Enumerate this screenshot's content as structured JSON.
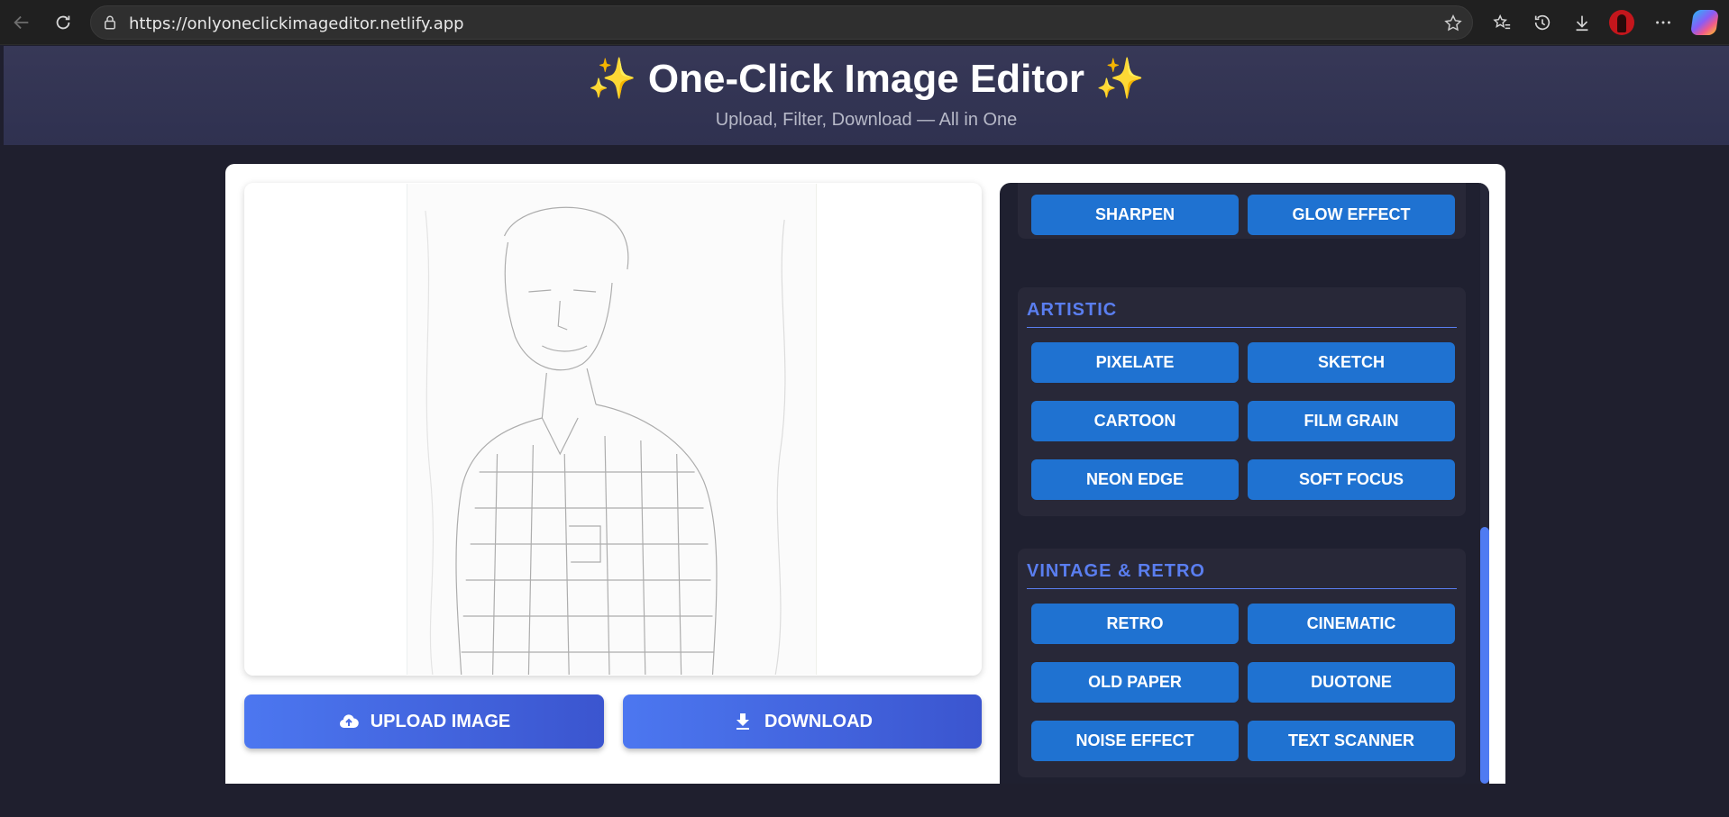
{
  "browser": {
    "url": "https://onlyoneclickimageditor.netlify.app"
  },
  "header": {
    "title": "✨ One-Click Image Editor ✨",
    "subtitle": "Upload, Filter, Download — All in One"
  },
  "actions": {
    "upload_label": "UPLOAD IMAGE",
    "download_label": "DOWNLOAD"
  },
  "filters": {
    "top": [
      "SHARPEN",
      "GLOW EFFECT"
    ],
    "artistic": {
      "title": "ARTISTIC",
      "buttons": [
        "PIXELATE",
        "SKETCH",
        "CARTOON",
        "FILM GRAIN",
        "NEON EDGE",
        "SOFT FOCUS"
      ]
    },
    "vintage": {
      "title": "VINTAGE & RETRO",
      "buttons": [
        "RETRO",
        "CINEMATIC",
        "OLD PAPER",
        "DUOTONE",
        "NOISE EFFECT",
        "TEXT SCANNER"
      ]
    }
  },
  "icons": {
    "back": "arrow-left-icon",
    "reload": "reload-icon",
    "site_info": "lock-icon",
    "favorite": "star-icon",
    "favorites": "favorites-icon",
    "history": "history-icon",
    "downloads": "download-icon",
    "more": "more-icon",
    "upload": "cloud-upload-icon",
    "download_action": "download-icon"
  },
  "colors": {
    "header_bg": "#373857",
    "page_bg": "#1f1f2e",
    "button_blue": "#1f72d1",
    "accent": "#5a7ef0",
    "action_gradient_start": "#4c77f0",
    "action_gradient_end": "#3b55cf"
  }
}
